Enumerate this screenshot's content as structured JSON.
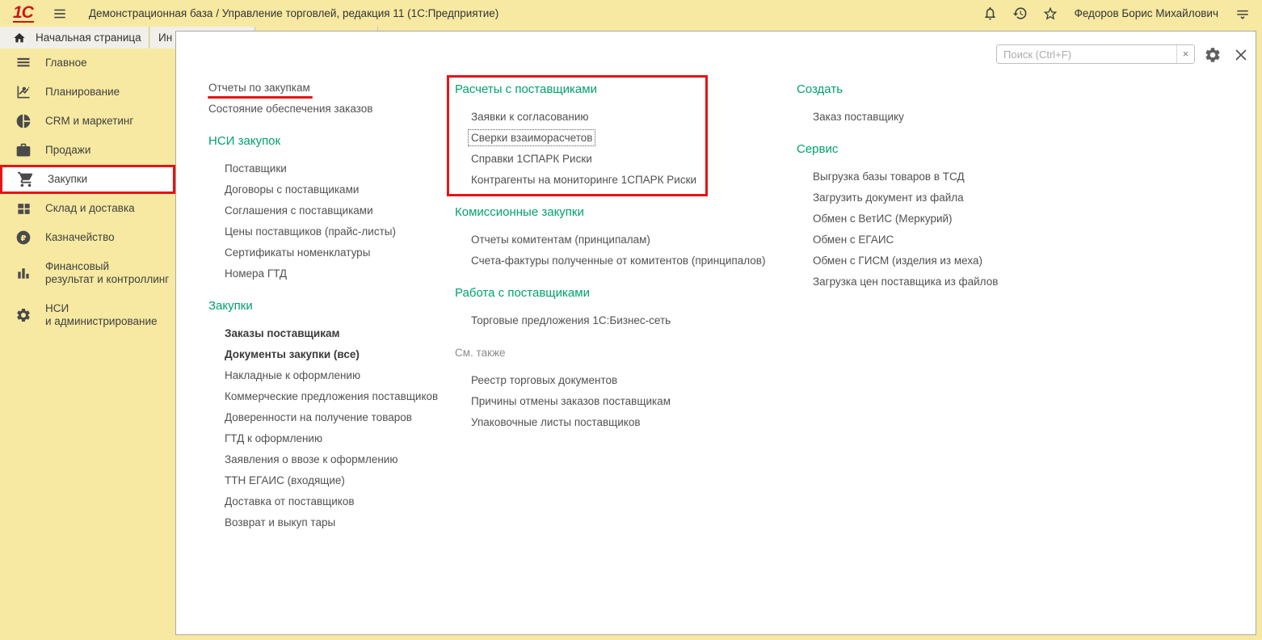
{
  "colors": {
    "background_yellow": "#f7e9a1",
    "panel_white": "#ffffff",
    "header_green": "#00a26b",
    "annotation_red": "#e81313",
    "link_gray": "#515151"
  },
  "titlebar": {
    "logo": "1С",
    "title": "Демонстрационная база / Управление торговлей, редакция 11  (1С:Предприятие)",
    "user": "Федоров Борис Михайлович",
    "left_icons": [
      "hamburger-menu-icon"
    ],
    "right_icons": [
      "bell-icon",
      "history-icon",
      "favorites-star-icon"
    ],
    "user_menu_icon": "user-menu-icon"
  },
  "tabs": [
    {
      "id": "home",
      "label": "Начальная страница",
      "icon": "home-icon"
    },
    {
      "id": "second",
      "label": "Ин"
    }
  ],
  "sidebar": {
    "items": [
      {
        "id": "glavnoe",
        "label": "Главное",
        "icon": "menu-lines-icon"
      },
      {
        "id": "planirovanie",
        "label": "Планирование",
        "icon": "planning-chart-icon"
      },
      {
        "id": "crm",
        "label": "CRM и маркетинг",
        "icon": "pie-chart-icon"
      },
      {
        "id": "prodazhi",
        "label": "Продажи",
        "icon": "briefcase-icon"
      },
      {
        "id": "zakupki",
        "label": "Закупки",
        "icon": "cart-icon",
        "active": true,
        "annotated": true
      },
      {
        "id": "sklad",
        "label": "Склад и доставка",
        "icon": "warehouse-grid-icon"
      },
      {
        "id": "kaznacheystvo",
        "label": "Казначейство",
        "icon": "ruble-icon"
      },
      {
        "id": "finrezultat",
        "lines": [
          "Финансовый",
          "результат и контроллинг"
        ],
        "icon": "bar-chart-icon"
      },
      {
        "id": "nsi",
        "lines": [
          "НСИ",
          "и администрирование"
        ],
        "icon": "gear-icon"
      }
    ]
  },
  "panel": {
    "search": {
      "placeholder": "Поиск (Ctrl+F)",
      "clear_icon": "search-clear-icon"
    },
    "toolbar_icons": [
      "settings-gear-icon",
      "close-icon"
    ],
    "columns": [
      {
        "groups": [
          {
            "id": "otchety",
            "header": null,
            "items": [
              {
                "label": "Отчеты по закупкам",
                "red_underline": true
              },
              {
                "label": "Состояние обеспечения заказов"
              }
            ]
          },
          {
            "id": "nsi-zakupok",
            "header": "НСИ закупок",
            "items": [
              {
                "label": "Поставщики"
              },
              {
                "label": "Договоры с поставщиками"
              },
              {
                "label": "Соглашения с поставщиками"
              },
              {
                "label": "Цены поставщиков (прайс-листы)"
              },
              {
                "label": "Сертификаты номенклатуры"
              },
              {
                "label": "Номера ГТД"
              }
            ]
          },
          {
            "id": "zakupki",
            "header": "Закупки",
            "items": [
              {
                "label": "Заказы поставщикам",
                "bold": true
              },
              {
                "label": "Документы закупки (все)",
                "bold": true
              },
              {
                "label": "Накладные к оформлению"
              },
              {
                "label": "Коммерческие предложения поставщиков"
              },
              {
                "label": "Доверенности на получение товаров"
              },
              {
                "label": "ГТД к оформлению"
              },
              {
                "label": "Заявления о ввозе к оформлению"
              },
              {
                "label": "ТТН ЕГАИС (входящие)"
              },
              {
                "label": "Доставка от поставщиков"
              },
              {
                "label": "Возврат и выкуп тары"
              }
            ]
          }
        ]
      },
      {
        "groups": [
          {
            "id": "raschety",
            "header": "Расчеты с поставщиками",
            "red_box": true,
            "items": [
              {
                "label": "Заявки к согласованию"
              },
              {
                "label": "Сверки взаиморасчетов",
                "focused": true
              },
              {
                "label": "Справки 1СПАРК Риски"
              },
              {
                "label": "Контрагенты на мониторинге 1СПАРК Риски"
              }
            ]
          },
          {
            "id": "komissionnye",
            "header": "Комиссионные закупки",
            "items": [
              {
                "label": "Отчеты комитентам (принципалам)"
              },
              {
                "label": "Счета-фактуры полученные от комитентов (принципалов)"
              }
            ]
          },
          {
            "id": "rabota",
            "header": "Работа с поставщиками",
            "items": [
              {
                "label": "Торговые предложения 1С:Бизнес-сеть"
              }
            ]
          },
          {
            "id": "sm-takzhe",
            "header": "См. также",
            "muted": true,
            "items": [
              {
                "label": "Реестр торговых документов"
              },
              {
                "label": "Причины отмены заказов поставщикам"
              },
              {
                "label": "Упаковочные листы поставщиков"
              }
            ]
          }
        ]
      },
      {
        "groups": [
          {
            "id": "sozdat",
            "header": "Создать",
            "items": [
              {
                "label": "Заказ поставщику"
              }
            ]
          },
          {
            "id": "servis",
            "header": "Сервис",
            "items": [
              {
                "label": "Выгрузка базы товаров в ТСД"
              },
              {
                "label": "Загрузить документ из файла"
              },
              {
                "label": "Обмен с ВетИС (Меркурий)"
              },
              {
                "label": "Обмен с ЕГАИС"
              },
              {
                "label": "Обмен с ГИСМ (изделия из меха)"
              },
              {
                "label": "Загрузка цен поставщика из файлов"
              }
            ]
          }
        ]
      }
    ]
  }
}
